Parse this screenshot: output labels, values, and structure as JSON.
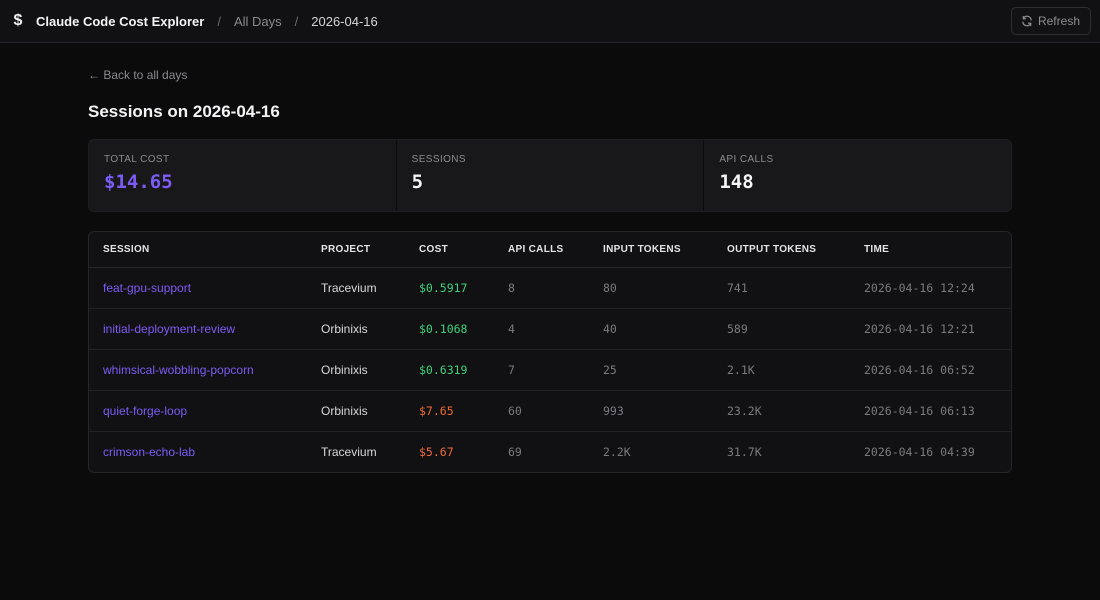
{
  "header": {
    "app_title": "Claude Code Cost Explorer",
    "brand_icon_glyph": "$",
    "crumb_sep": "/",
    "crumb_all_days": "All Days",
    "crumb_current": "2026-04-16",
    "refresh_label": "Refresh"
  },
  "back_link": "← Back to all days",
  "page_title": "Sessions on 2026-04-16",
  "stats": {
    "total_cost_label": "TOTAL COST",
    "total_cost_value": "$14.65",
    "sessions_label": "SESSIONS",
    "sessions_value": "5",
    "api_calls_label": "API CALLS",
    "api_calls_value": "148"
  },
  "table": {
    "columns": [
      "SESSION",
      "PROJECT",
      "COST",
      "API CALLS",
      "INPUT TOKENS",
      "OUTPUT TOKENS",
      "TIME"
    ],
    "rows": [
      {
        "session": "feat-gpu-support",
        "project": "Tracevium",
        "cost": "$0.5917",
        "cost_level": "low",
        "api_calls": "8",
        "input_tokens": "80",
        "output_tokens": "741",
        "time": "2026-04-16 12:24"
      },
      {
        "session": "initial-deployment-review",
        "project": "Orbinixis",
        "cost": "$0.1068",
        "cost_level": "low",
        "api_calls": "4",
        "input_tokens": "40",
        "output_tokens": "589",
        "time": "2026-04-16 12:21"
      },
      {
        "session": "whimsical-wobbling-popcorn",
        "project": "Orbinixis",
        "cost": "$0.6319",
        "cost_level": "low",
        "api_calls": "7",
        "input_tokens": "25",
        "output_tokens": "2.1K",
        "time": "2026-04-16 06:52"
      },
      {
        "session": "quiet-forge-loop",
        "project": "Orbinixis",
        "cost": "$7.65",
        "cost_level": "high",
        "api_calls": "60",
        "input_tokens": "993",
        "output_tokens": "23.2K",
        "time": "2026-04-16 06:13"
      },
      {
        "session": "crimson-echo-lab",
        "project": "Tracevium",
        "cost": "$5.67",
        "cost_level": "high",
        "api_calls": "69",
        "input_tokens": "2.2K",
        "output_tokens": "31.7K",
        "time": "2026-04-16 04:39"
      }
    ]
  },
  "colors": {
    "accent": "#7c5cf5",
    "cost_low": "#3ed07a",
    "cost_high": "#f06a3a",
    "background": "#0b0b0c"
  },
  "icons": {
    "brand": "dollar-icon",
    "refresh": "refresh-icon"
  }
}
